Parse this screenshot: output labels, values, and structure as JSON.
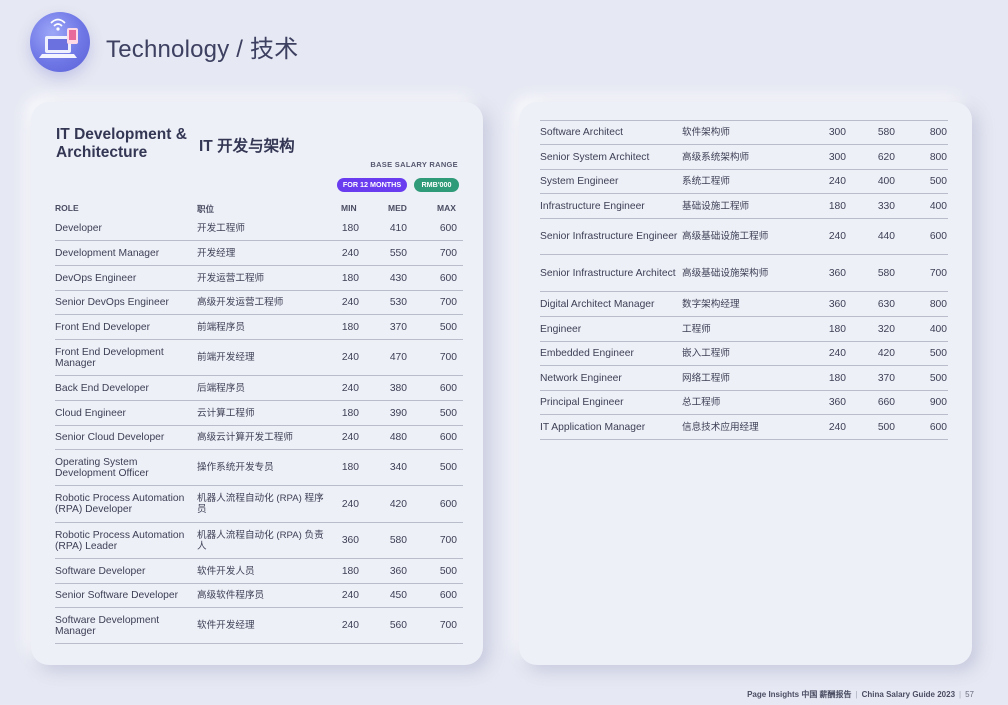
{
  "header": {
    "title": "Technology / 技术"
  },
  "section": {
    "title_en": "IT Development & Architecture",
    "title_cn": "IT 开发与架构",
    "range_label": "BASE SALARY RANGE",
    "pill_months": "FOR 12 MONTHS",
    "pill_rmb": "RMB'000"
  },
  "columns": {
    "role": "ROLE",
    "cn": "职位",
    "min": "MIN",
    "med": "MED",
    "max": "MAX"
  },
  "left_rows": [
    {
      "en": "Developer",
      "cn": "开发工程师",
      "min": "180",
      "med": "410",
      "max": "600"
    },
    {
      "en": "Development Manager",
      "cn": "开发经理",
      "min": "240",
      "med": "550",
      "max": "700"
    },
    {
      "en": "DevOps Engineer",
      "cn": "开发运营工程师",
      "min": "180",
      "med": "430",
      "max": "600"
    },
    {
      "en": "Senior DevOps Engineer",
      "cn": "高级开发运营工程师",
      "min": "240",
      "med": "530",
      "max": "700"
    },
    {
      "en": "Front End Developer",
      "cn": "前端程序员",
      "min": "180",
      "med": "370",
      "max": "500"
    },
    {
      "en": "Front End Development Manager",
      "cn": "前端开发经理",
      "min": "240",
      "med": "470",
      "max": "700"
    },
    {
      "en": "Back End Developer",
      "cn": "后端程序员",
      "min": "240",
      "med": "380",
      "max": "600"
    },
    {
      "en": "Cloud Engineer",
      "cn": "云计算工程师",
      "min": "180",
      "med": "390",
      "max": "500"
    },
    {
      "en": "Senior Cloud Developer",
      "cn": "高级云计算开发工程师",
      "min": "240",
      "med": "480",
      "max": "600"
    },
    {
      "en": "Operating System Development Officer",
      "cn": "操作系统开发专员",
      "min": "180",
      "med": "340",
      "max": "500"
    },
    {
      "en": "Robotic Process Automation (RPA) Developer",
      "cn": "机器人流程自动化 (RPA) 程序员",
      "min": "240",
      "med": "420",
      "max": "600"
    },
    {
      "en": "Robotic Process Automation (RPA) Leader",
      "cn": "机器人流程自动化 (RPA) 负责人",
      "min": "360",
      "med": "580",
      "max": "700"
    },
    {
      "en": "Software Developer",
      "cn": "软件开发人员",
      "min": "180",
      "med": "360",
      "max": "500"
    },
    {
      "en": "Senior Software Developer",
      "cn": "高级软件程序员",
      "min": "240",
      "med": "450",
      "max": "600"
    },
    {
      "en": "Software Development Manager",
      "cn": "软件开发经理",
      "min": "240",
      "med": "560",
      "max": "700"
    }
  ],
  "right_rows": [
    {
      "en": "Software Architect",
      "cn": "软件架构师",
      "min": "300",
      "med": "580",
      "max": "800"
    },
    {
      "en": "Senior System Architect",
      "cn": "高级系统架构师",
      "min": "300",
      "med": "620",
      "max": "800"
    },
    {
      "en": "System Engineer",
      "cn": "系统工程师",
      "min": "240",
      "med": "400",
      "max": "500"
    },
    {
      "en": "Infrastructure Engineer",
      "cn": "基础设施工程师",
      "min": "180",
      "med": "330",
      "max": "400"
    },
    {
      "en": "Senior Infrastructure Engineer",
      "cn": "高级基础设施工程师",
      "min": "240",
      "med": "440",
      "max": "600"
    },
    {
      "en": "Senior Infrastructure Architect",
      "cn": "高级基础设施架构师",
      "min": "360",
      "med": "580",
      "max": "700"
    },
    {
      "en": "Digital Architect Manager",
      "cn": "数字架构经理",
      "min": "360",
      "med": "630",
      "max": "800"
    },
    {
      "en": "Engineer",
      "cn": "工程师",
      "min": "180",
      "med": "320",
      "max": "400"
    },
    {
      "en": "Embedded Engineer",
      "cn": "嵌入工程师",
      "min": "240",
      "med": "420",
      "max": "500"
    },
    {
      "en": "Network Engineer",
      "cn": "网络工程师",
      "min": "180",
      "med": "370",
      "max": "500"
    },
    {
      "en": "Principal Engineer",
      "cn": "总工程师",
      "min": "360",
      "med": "660",
      "max": "900"
    },
    {
      "en": "IT Application Manager",
      "cn": "信息技术应用经理",
      "min": "240",
      "med": "500",
      "max": "600"
    }
  ],
  "footer": {
    "brand": "Page Insights 中国 薪酬报告",
    "guide": "China Salary Guide 2023",
    "page": "57"
  }
}
